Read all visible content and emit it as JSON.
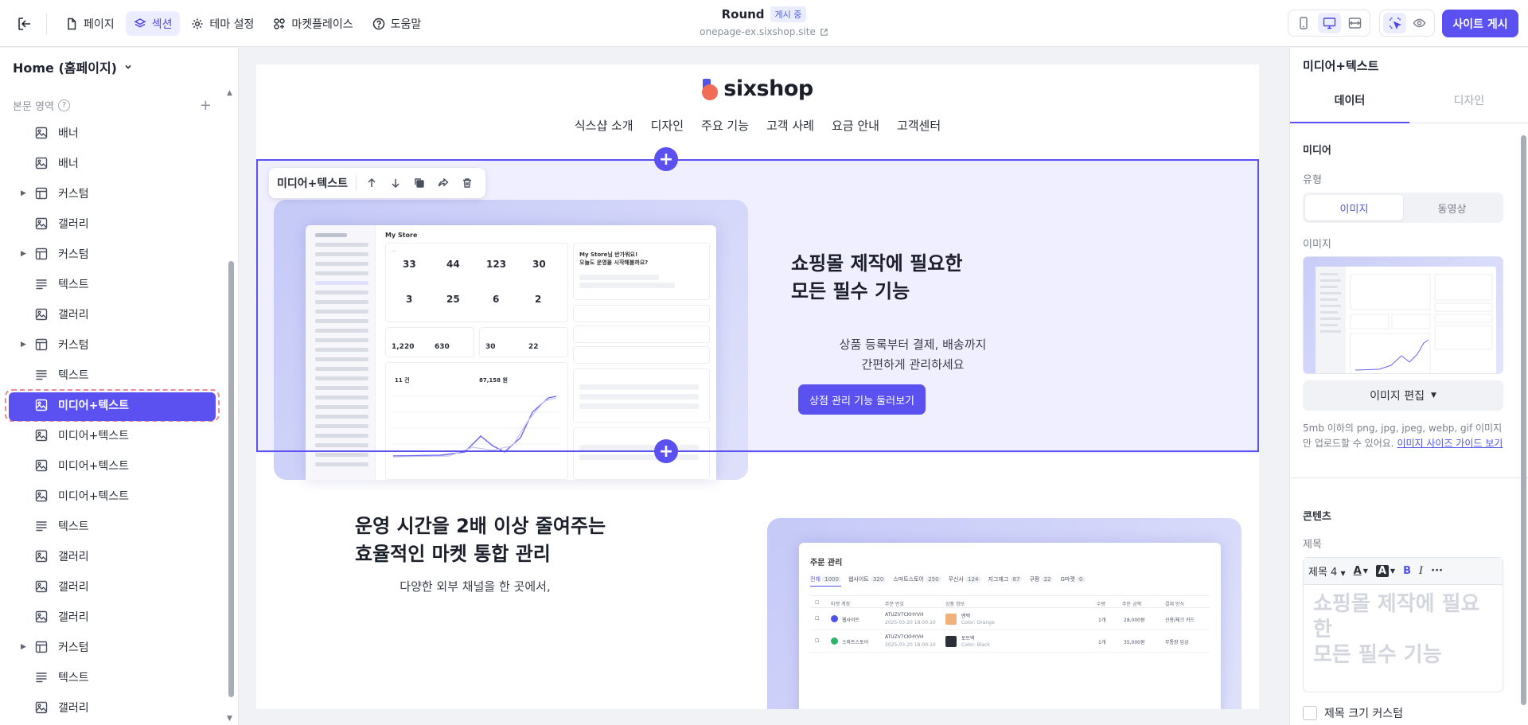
{
  "topbar": {
    "nav": [
      {
        "label": "페이지",
        "icon": "file-icon"
      },
      {
        "label": "섹션",
        "icon": "layers-icon"
      },
      {
        "label": "테마 설정",
        "icon": "gear-icon"
      },
      {
        "label": "마켓플레이스",
        "icon": "grid-plus-icon"
      },
      {
        "label": "도움말",
        "icon": "help-circle-icon"
      }
    ],
    "site_title": "Round",
    "status_badge": "게시 중",
    "site_url": "onepage-ex.sixshop.site",
    "publish_label": "사이트 게시"
  },
  "left_panel": {
    "page_select": "Home (홈페이지)",
    "section_header": "본문 영역",
    "items": [
      {
        "label": "배너",
        "icon": "image-icon",
        "expandable": false
      },
      {
        "label": "배너",
        "icon": "image-icon",
        "expandable": false
      },
      {
        "label": "커스텀",
        "icon": "layout-icon",
        "expandable": true
      },
      {
        "label": "갤러리",
        "icon": "image-icon",
        "expandable": false
      },
      {
        "label": "커스텀",
        "icon": "layout-icon",
        "expandable": true
      },
      {
        "label": "텍스트",
        "icon": "text-icon",
        "expandable": false
      },
      {
        "label": "갤러리",
        "icon": "image-icon",
        "expandable": false
      },
      {
        "label": "커스텀",
        "icon": "layout-icon",
        "expandable": true
      },
      {
        "label": "텍스트",
        "icon": "text-icon",
        "expandable": false
      },
      {
        "label": "미디어+텍스트",
        "icon": "image-icon",
        "expandable": false,
        "selected": true
      },
      {
        "label": "미디어+텍스트",
        "icon": "image-icon",
        "expandable": false
      },
      {
        "label": "미디어+텍스트",
        "icon": "image-icon",
        "expandable": false
      },
      {
        "label": "미디어+텍스트",
        "icon": "image-icon",
        "expandable": false
      },
      {
        "label": "텍스트",
        "icon": "text-icon",
        "expandable": false
      },
      {
        "label": "갤러리",
        "icon": "image-icon",
        "expandable": false
      },
      {
        "label": "갤러리",
        "icon": "image-icon",
        "expandable": false
      },
      {
        "label": "갤러리",
        "icon": "image-icon",
        "expandable": false
      },
      {
        "label": "커스텀",
        "icon": "layout-icon",
        "expandable": true
      },
      {
        "label": "텍스트",
        "icon": "text-icon",
        "expandable": false
      },
      {
        "label": "갤러리",
        "icon": "image-icon",
        "expandable": false
      }
    ]
  },
  "canvas": {
    "logo_text": "sixshop",
    "site_nav": [
      "식스샵 소개",
      "디자인",
      "주요 기능",
      "고객 사례",
      "요금 안내",
      "고객센터"
    ],
    "section_toolbar_label": "미디어+텍스트",
    "section_a": {
      "heading_line1": "쇼핑몰 제작에 필요한",
      "heading_line2": "모든 필수 기능",
      "body_line1": "상품 등록부터 결제, 배송까지",
      "body_line2": "간편하게 관리하세요",
      "cta": "상점 관리 기능 둘러보기",
      "mock": {
        "title": "My Store",
        "stats": [
          "33",
          "44",
          "123",
          "30",
          "3",
          "25",
          "6",
          "2"
        ],
        "stats2": [
          "1,220",
          "630",
          "30",
          "22"
        ],
        "orders_count": "11 건",
        "orders_amount": "87,158 원",
        "welcome_line1": "My Store님 반가워요!",
        "welcome_line2": "오늘도 운영을 시작해볼까요?"
      }
    },
    "section_b": {
      "heading_line1": "운영 시간을 2배 이상 줄여주는",
      "heading_line2": "효율적인 마켓 통합 관리",
      "body_line1": "다양한 외부 채널을 한 곳에서,",
      "mock": {
        "title": "주문 관리",
        "tabs": [
          {
            "label": "전체",
            "count": "1000"
          },
          {
            "label": "웹사이트",
            "count": "320"
          },
          {
            "label": "스마트스토어",
            "count": "250"
          },
          {
            "label": "무신사",
            "count": "124"
          },
          {
            "label": "지그재그",
            "count": "87"
          },
          {
            "label": "쿠팡",
            "count": "22"
          },
          {
            "label": "G마켓",
            "count": "0"
          }
        ],
        "columns": [
          "마켓 계정",
          "주문 번호",
          "상품 정보",
          "수량",
          "주문 금액",
          "결제 방식"
        ],
        "rows": [
          {
            "market": "웹사이트",
            "order": "ATUZV7CKHYVH",
            "date": "2025-03-20 18:00:10",
            "product": "맨백",
            "option": "Color: Orange",
            "qty": "1개",
            "amount": "28,000원",
            "pay": "신용/체크 카드"
          },
          {
            "market": "스마트스토어",
            "order": "ATUZV7CKHYVH",
            "date": "2025-03-20 18:00:10",
            "product": "토트백",
            "option": "Color: Black",
            "qty": "1개",
            "amount": "35,000원",
            "pay": "무통장 입금"
          }
        ]
      }
    }
  },
  "right_panel": {
    "title": "미디어+텍스트",
    "tabs": [
      "데이터",
      "디자인"
    ],
    "media_header": "미디어",
    "type_label": "유형",
    "type_options": [
      "이미지",
      "동영상"
    ],
    "image_label": "이미지",
    "image_edit": "이미지 편집",
    "note": "5mb 이하의 png, jpg, jpeg, webp, gif 이미지만 업로드할 수 있어요. ",
    "note_link": "이미지 사이즈 가이드 보기",
    "content_header": "콘텐츠",
    "title_label": "제목",
    "heading_select": "제목 4",
    "editor_text_line1": "쇼핑몰 제작에 필요한",
    "editor_text_line2": "모든 필수 기능",
    "custom_size_label": "제목 크기 커스텀"
  },
  "colors": {
    "accent": "#5b50f0",
    "selection_outline": "#ea8b8f",
    "section_bg": "#f0efff"
  }
}
